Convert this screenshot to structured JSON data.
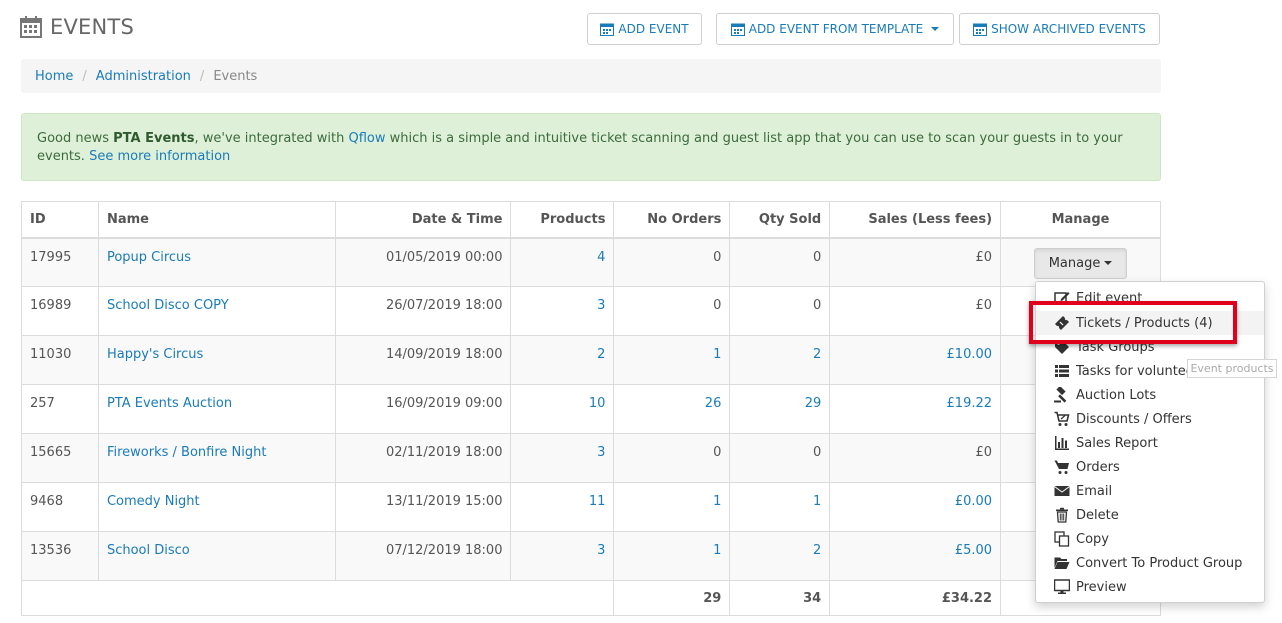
{
  "header": {
    "title": "EVENTS",
    "title_icon": "calendar-icon",
    "buttons": {
      "add_event": "ADD EVENT",
      "add_from_template": "ADD EVENT FROM TEMPLATE",
      "show_archived": "SHOW ARCHIVED EVENTS"
    }
  },
  "breadcrumb": {
    "home": "Home",
    "admin": "Administration",
    "current": "Events",
    "separator": "/"
  },
  "alert": {
    "prefix": "Good news ",
    "org": "PTA Events",
    "middle": ", we've integrated with ",
    "qflow": "Qflow",
    "suffix": " which is a simple and intuitive ticket scanning and guest list app that you can use to scan your guests in to your events. ",
    "link": "See more information"
  },
  "table": {
    "headers": {
      "id": "ID",
      "name": "Name",
      "date": "Date & Time",
      "products": "Products",
      "no_orders": "No Orders",
      "qty_sold": "Qty Sold",
      "sales": "Sales (Less fees)",
      "manage": "Manage"
    },
    "rows": [
      {
        "id": "17995",
        "name": "Popup Circus",
        "date": "01/05/2019 00:00",
        "products": "4",
        "no_orders": "0",
        "qty_sold": "0",
        "sales": "£0"
      },
      {
        "id": "16989",
        "name": "School Disco COPY",
        "date": "26/07/2019 18:00",
        "products": "3",
        "no_orders": "0",
        "qty_sold": "0",
        "sales": "£0"
      },
      {
        "id": "11030",
        "name": "Happy's Circus",
        "date": "14/09/2019 18:00",
        "products": "2",
        "no_orders": "1",
        "qty_sold": "2",
        "sales": "£10.00"
      },
      {
        "id": "257",
        "name": "PTA Events Auction",
        "date": "16/09/2019 09:00",
        "products": "10",
        "no_orders": "26",
        "qty_sold": "29",
        "sales": "£19.22"
      },
      {
        "id": "15665",
        "name": "Fireworks / Bonfire Night",
        "date": "02/11/2019 18:00",
        "products": "3",
        "no_orders": "0",
        "qty_sold": "0",
        "sales": "£0"
      },
      {
        "id": "9468",
        "name": "Comedy Night",
        "date": "13/11/2019 15:00",
        "products": "11",
        "no_orders": "1",
        "qty_sold": "1",
        "sales": "£0.00"
      },
      {
        "id": "13536",
        "name": "School Disco",
        "date": "07/12/2019 18:00",
        "products": "3",
        "no_orders": "1",
        "qty_sold": "2",
        "sales": "£5.00"
      }
    ],
    "totals": {
      "no_orders": "29",
      "qty_sold": "34",
      "sales": "£34.22"
    },
    "manage_button": "Manage"
  },
  "menu": {
    "items": [
      {
        "label": "Edit event",
        "icon": "edit-icon"
      },
      {
        "label": "Tickets / Products (4)",
        "icon": "ticket-icon"
      },
      {
        "label": "Task Groups",
        "icon": "tag-icon"
      },
      {
        "label": "Tasks for volunteers",
        "icon": "list-icon"
      },
      {
        "label": "Auction Lots",
        "icon": "gavel-icon"
      },
      {
        "label": "Discounts / Offers",
        "icon": "cart-discount-icon"
      },
      {
        "label": "Sales Report",
        "icon": "bar-chart-icon"
      },
      {
        "label": "Orders",
        "icon": "cart-icon"
      },
      {
        "label": "Email",
        "icon": "envelope-icon"
      },
      {
        "label": "Delete",
        "icon": "trash-icon"
      },
      {
        "label": "Copy",
        "icon": "copy-icon"
      },
      {
        "label": "Convert To Product Group",
        "icon": "folder-open-icon"
      },
      {
        "label": "Preview",
        "icon": "monitor-icon"
      }
    ],
    "tooltip": "Event products"
  },
  "colors": {
    "link": "#1a7bb9",
    "alert_bg": "#dff0d8",
    "highlight": "#e0001b"
  }
}
